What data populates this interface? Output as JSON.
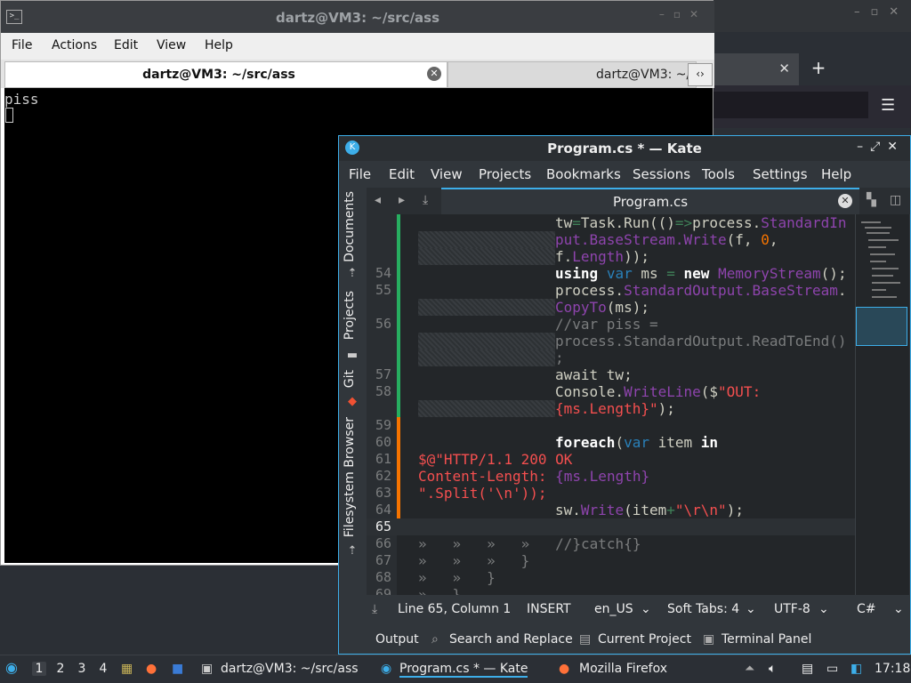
{
  "terminal": {
    "title": "dartz@VM3: ~/src/ass",
    "menu": [
      "File",
      "Actions",
      "Edit",
      "View",
      "Help"
    ],
    "tab_active": "dartz@VM3: ~/src/ass",
    "tab_second": "dartz@VM3: ~/",
    "output_line": "piss"
  },
  "kate": {
    "title": "Program.cs * — Kate",
    "menu": [
      "File",
      "Edit",
      "View",
      "Projects",
      "Bookmarks",
      "Sessions",
      "Tools",
      "Settings",
      "Help"
    ],
    "side_tabs": [
      "Documents",
      "Projects",
      "Git",
      "Filesystem Browser"
    ],
    "doc_tab": "Program.cs",
    "line_numbers": [
      "",
      "",
      "",
      "54",
      "55",
      "",
      "56",
      "",
      "",
      "57",
      "58",
      "",
      "59",
      "60",
      "61",
      "62",
      "63",
      "64",
      "65",
      "66",
      "67",
      "68",
      "69"
    ],
    "status": {
      "position": "Line 65, Column 1",
      "mode": "INSERT",
      "dictionary": "en_US",
      "indent": "Soft Tabs: 4",
      "encoding": "UTF-8",
      "syntax": "C#"
    },
    "tool_views": [
      "Output",
      "Search and Replace",
      "Current Project",
      "Terminal Panel"
    ]
  },
  "taskbar": {
    "workspaces": [
      "1",
      "2",
      "3",
      "4"
    ],
    "tasks": [
      "dartz@VM3: ~/src/ass",
      "Program.cs * — Kate",
      "Mozilla Firefox"
    ],
    "clock": "17:18"
  },
  "colors": {
    "accent": "#3daee9",
    "editor_bg": "#232629",
    "terminal_bg": "#000000",
    "modified_line": "#f67400",
    "saved_line": "#27ae60"
  }
}
